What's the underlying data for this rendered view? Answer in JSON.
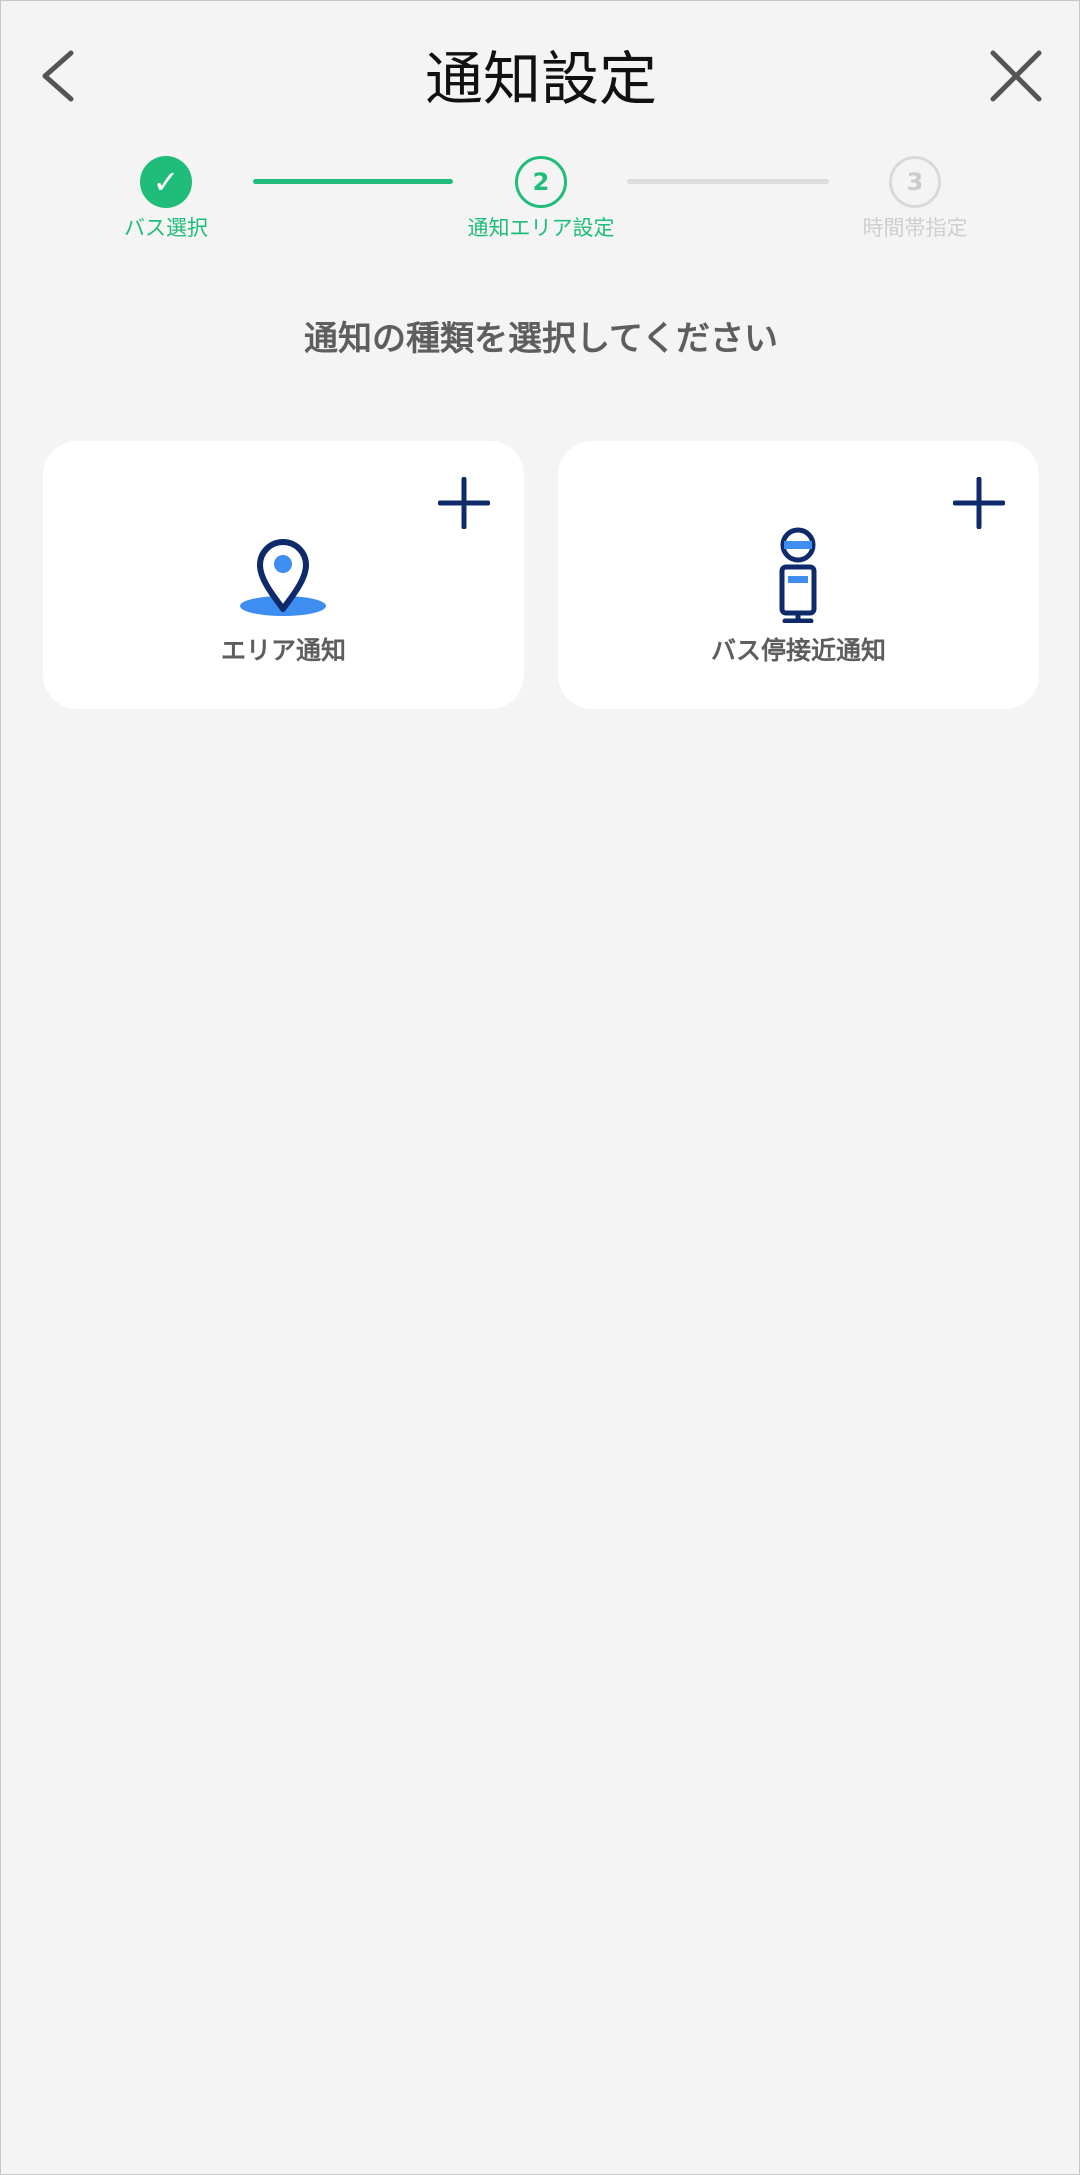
{
  "header": {
    "title": "通知設定",
    "back_icon": "chevron-left-icon",
    "close_icon": "close-icon"
  },
  "stepper": {
    "steps": [
      {
        "number": "1",
        "label": "バス選択",
        "state": "completed",
        "icon": "check-icon"
      },
      {
        "number": "2",
        "label": "通知エリア設定",
        "state": "current"
      },
      {
        "number": "3",
        "label": "時間帯指定",
        "state": "upcoming"
      }
    ],
    "active_color": "#20bd7a",
    "inactive_color": "#d9d9d9"
  },
  "main": {
    "instruction": "通知の種類を選択してください",
    "options": [
      {
        "label": "エリア通知",
        "icon": "map-pin-icon",
        "action_icon": "plus-icon"
      },
      {
        "label": "バス停接近通知",
        "icon": "bus-stop-icon",
        "action_icon": "plus-icon"
      }
    ]
  },
  "colors": {
    "accent": "#20bd7a",
    "icon_navy": "#0e2a6b",
    "icon_blue": "#3d8ef0",
    "background": "#f4f4f4"
  }
}
